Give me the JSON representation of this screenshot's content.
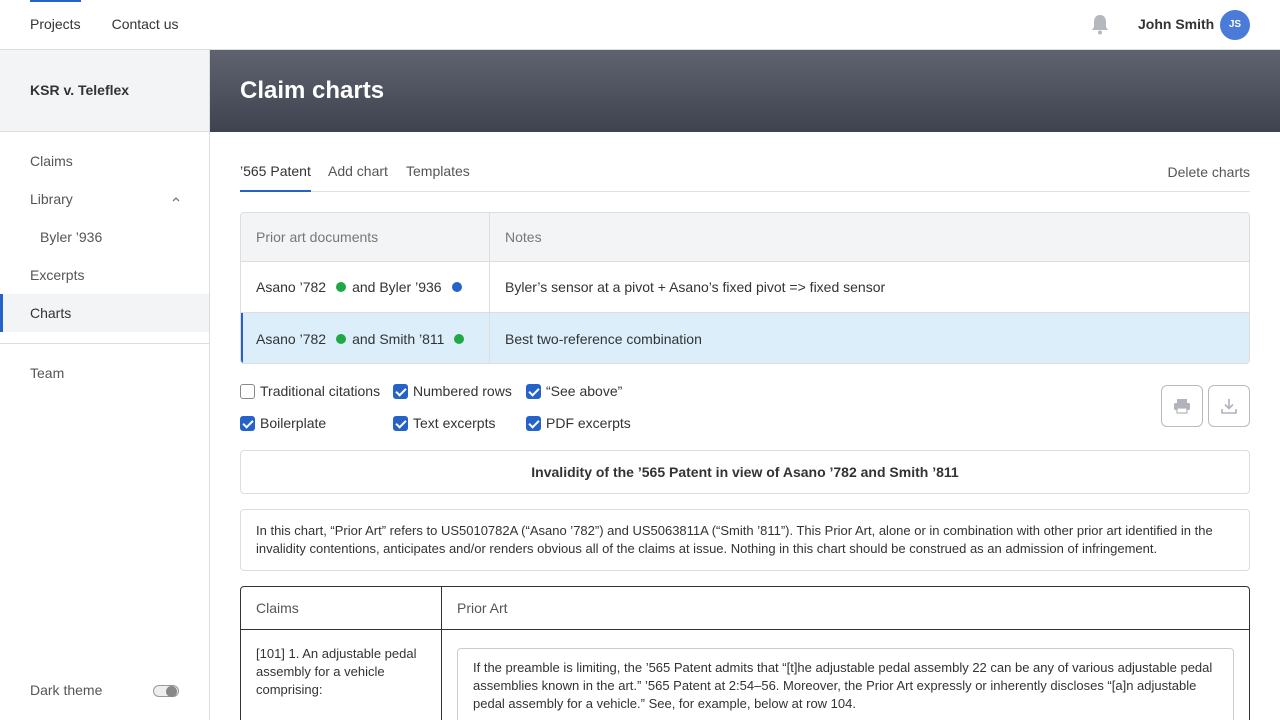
{
  "topnav": {
    "projects": "Projects",
    "contact": "Contact us"
  },
  "user": {
    "name": "John Smith",
    "initials": "JS"
  },
  "sidebar": {
    "case_name": "KSR v. Teleflex",
    "items": [
      {
        "label": "Claims"
      },
      {
        "label": "Library"
      },
      {
        "label": "Byler ’936"
      },
      {
        "label": "Excerpts"
      },
      {
        "label": "Charts"
      }
    ],
    "team": "Team",
    "dark_theme": "Dark theme"
  },
  "header": {
    "title": "Claim charts"
  },
  "tabs": {
    "items": [
      "’565 Patent",
      "Add chart",
      "Templates"
    ],
    "delete": "Delete charts"
  },
  "prior_art_table": {
    "headers": [
      "Prior art documents",
      "Notes"
    ],
    "rows": [
      {
        "doc1": "Asano ’782",
        "conj": "and",
        "doc2": "Byler ’936",
        "note": "Byler’s sensor at a pivot + Asano’s fixed pivot => fixed sensor"
      },
      {
        "doc1": "Asano ’782",
        "conj": "and",
        "doc2": "Smith ’811",
        "note": "Best two-reference combination"
      }
    ]
  },
  "options": {
    "traditional": "Traditional citations",
    "numbered": "Numbered rows",
    "see_above": "“See above”",
    "boilerplate": "Boilerplate",
    "text_excerpts": "Text excerpts",
    "pdf_excerpts": "PDF excerpts"
  },
  "chart": {
    "title": "Invalidity of the ’565 Patent in view of Asano ’782 and Smith ’811",
    "intro": "In this chart, “Prior Art” refers to US5010782A (“Asano ’782”) and US5063811A (“Smith ’811”). This Prior Art, alone or in combination with other prior art identified in the invalidity contentions, anticipates and/or renders obvious all of the claims at issue. Nothing in this chart should be construed as an admission of infringement.",
    "headers": [
      "Claims",
      "Prior Art"
    ],
    "claim_text": "[101] 1. An adjustable pedal assembly for a vehicle comprising:",
    "art_text": "If the preamble is limiting, the ’565 Patent admits that “[t]he adjustable pedal assembly 22 can be any of various adjustable pedal assemblies known in the art.” ’565 Patent at 2:54–56. Moreover, the Prior Art expressly or inherently discloses “[a]n adjustable pedal assembly for a vehicle.” See, for example, below at row 104."
  },
  "colors": {
    "accent": "#2563c9",
    "dot_green": "#22a745",
    "dot_blue": "#2563c9",
    "selected_row": "#dbeefa"
  }
}
